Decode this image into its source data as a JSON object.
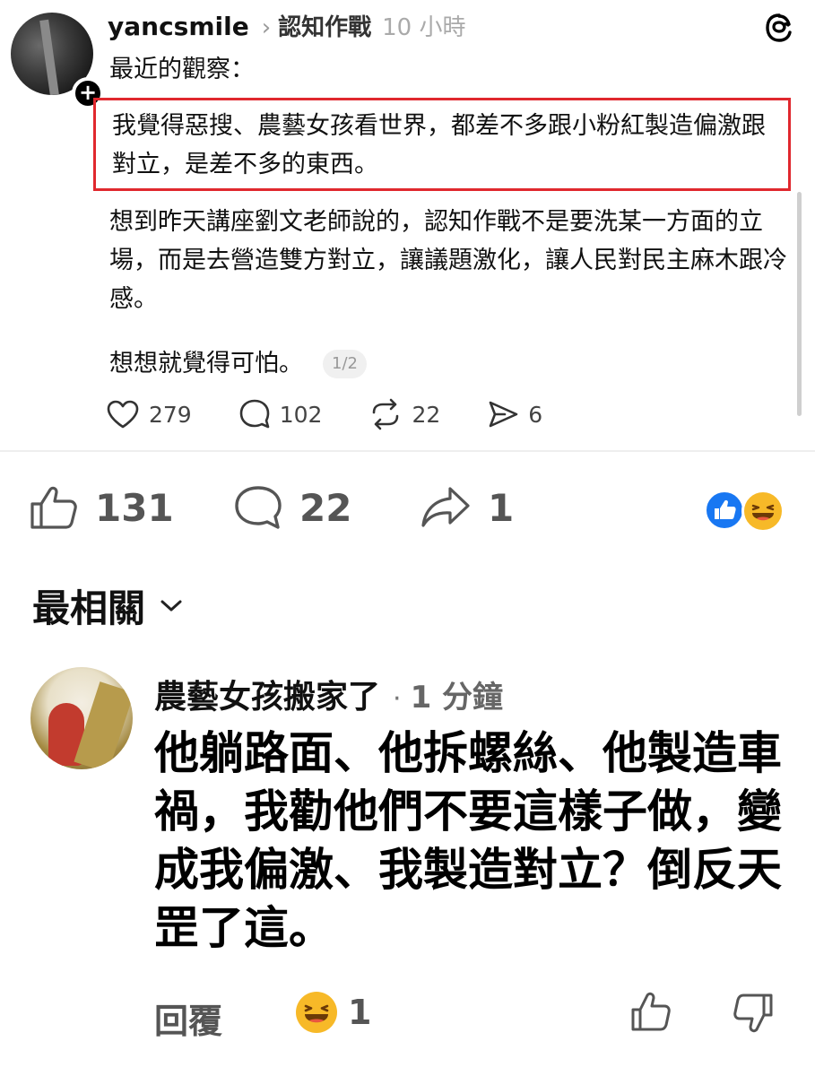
{
  "threads_post": {
    "username": "yancsmile",
    "topic": "認知作戰",
    "time": "10 小時",
    "intro": "最近的觀察：",
    "highlighted_text": "我覺得惡搜、農藝女孩看世界，都差不多跟小粉紅製造偏激跟對立，是差不多的東西。",
    "paragraph": "想到昨天講座劉文老師說的，認知作戰不是要洗某一方面的立場，而是去營造雙方對立，讓議題激化，讓人民對民主麻木跟冷感。",
    "closing": "想想就覺得可怕。",
    "page_indicator": "1/2",
    "likes": "279",
    "comments": "102",
    "reposts": "22",
    "shares": "6",
    "highlight_color": "#e0282e"
  },
  "fb_post_stats": {
    "likes": "131",
    "comments": "22",
    "shares": "1"
  },
  "sort": {
    "label": "最相關"
  },
  "comment": {
    "author": "農藝女孩搬家了",
    "dot": "·",
    "time": "1 分鐘",
    "text": "他躺路面、他拆螺絲、他製造車禍，我勸他們不要這樣子做，變成我偏激、我製造對立？倒反天罡了這。",
    "reply_label": "回覆",
    "reaction_count": "1"
  },
  "colors": {
    "fb_blue": "#1877f2",
    "haha_yellow": "#f7b928"
  }
}
